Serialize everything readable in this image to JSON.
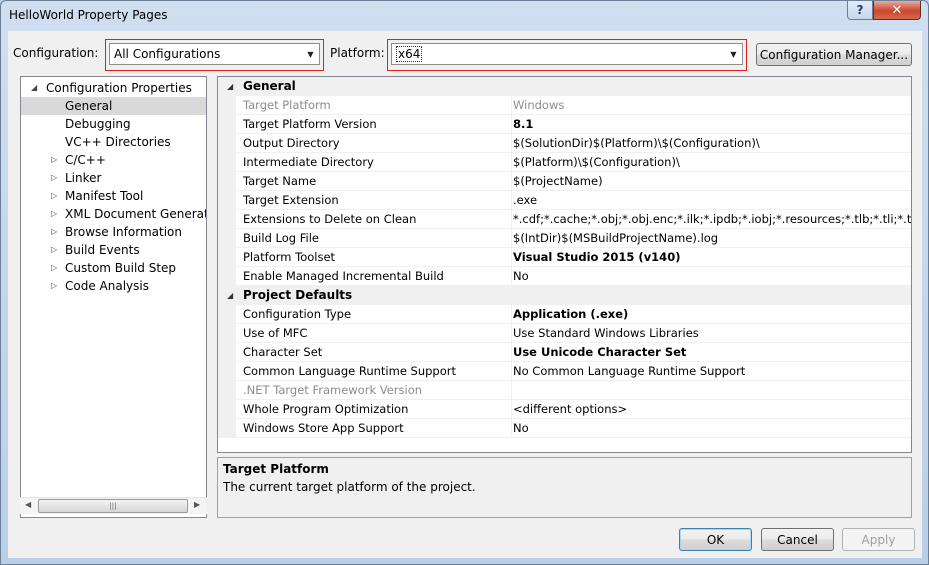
{
  "window": {
    "title": "HelloWorld Property Pages",
    "help_glyph": "?",
    "close_glyph": "✕"
  },
  "toolbar": {
    "configuration_label": "Configuration:",
    "configuration_value": "All Configurations",
    "platform_label": "Platform:",
    "platform_value": "x64",
    "config_manager_label": "Configuration Manager..."
  },
  "tree": {
    "items": [
      {
        "label": "Configuration Properties",
        "expander": "◢"
      },
      {
        "label": "General"
      },
      {
        "label": "Debugging"
      },
      {
        "label": "VC++ Directories"
      },
      {
        "label": "C/C++",
        "expander": "▷"
      },
      {
        "label": "Linker",
        "expander": "▷"
      },
      {
        "label": "Manifest Tool",
        "expander": "▷"
      },
      {
        "label": "XML Document Generator",
        "expander": "▷"
      },
      {
        "label": "Browse Information",
        "expander": "▷"
      },
      {
        "label": "Build Events",
        "expander": "▷"
      },
      {
        "label": "Custom Build Step",
        "expander": "▷"
      },
      {
        "label": "Code Analysis",
        "expander": "▷"
      }
    ],
    "scroll_left": "◀",
    "scroll_right": "▶",
    "scroll_grip": "|||"
  },
  "grid": {
    "categories": [
      {
        "name": "General",
        "expander": "◢"
      },
      {
        "name": "Project Defaults",
        "expander": "◢"
      }
    ],
    "general": [
      {
        "name": "Target Platform",
        "value": "Windows"
      },
      {
        "name": "Target Platform Version",
        "value": "8.1"
      },
      {
        "name": "Output Directory",
        "value": "$(SolutionDir)$(Platform)\\$(Configuration)\\"
      },
      {
        "name": "Intermediate Directory",
        "value": "$(Platform)\\$(Configuration)\\"
      },
      {
        "name": "Target Name",
        "value": "$(ProjectName)"
      },
      {
        "name": "Target Extension",
        "value": ".exe"
      },
      {
        "name": "Extensions to Delete on Clean",
        "value": "*.cdf;*.cache;*.obj;*.obj.enc;*.ilk;*.ipdb;*.iobj;*.resources;*.tlb;*.tli;*.tlh;*.tmp;"
      },
      {
        "name": "Build Log File",
        "value": "$(IntDir)$(MSBuildProjectName).log"
      },
      {
        "name": "Platform Toolset",
        "value": "Visual Studio 2015 (v140)"
      },
      {
        "name": "Enable Managed Incremental Build",
        "value": "No"
      }
    ],
    "defaults": [
      {
        "name": "Configuration Type",
        "value": "Application (.exe)"
      },
      {
        "name": "Use of MFC",
        "value": "Use Standard Windows Libraries"
      },
      {
        "name": "Character Set",
        "value": "Use Unicode Character Set"
      },
      {
        "name": "Common Language Runtime Support",
        "value": "No Common Language Runtime Support"
      },
      {
        "name": ".NET Target Framework Version",
        "value": ""
      },
      {
        "name": "Whole Program Optimization",
        "value": "<different options>"
      },
      {
        "name": "Windows Store App Support",
        "value": "No"
      }
    ]
  },
  "description": {
    "title": "Target Platform",
    "text": "The current target platform of the project."
  },
  "buttons": {
    "ok": "OK",
    "cancel": "Cancel",
    "apply": "Apply"
  }
}
